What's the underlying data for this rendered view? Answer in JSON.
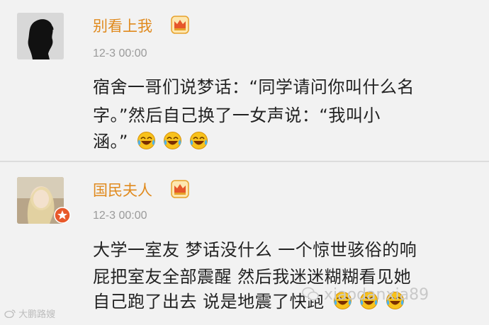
{
  "comments": [
    {
      "username": "别看上我",
      "time": "12-3 00:00",
      "lines": [
        "宿舍一哥们说梦话：“同学请问你叫什么名",
        "字。”然后自己换了一女声说：“我叫小",
        "涵。”"
      ],
      "emojis": [
        "laugh-cry-emoji",
        "laugh-cry-emoji",
        "laugh-cry-emoji"
      ]
    },
    {
      "username": "国民夫人",
      "time": "12-3 00:00",
      "lines": [
        "大学一室友 梦话没什么 一个惊世骇俗的响",
        "屁把室友全部震醒 然后我迷迷糊糊看见她",
        "自己跑了出去 说是地震了快跑"
      ],
      "emojis": [
        "laugh-cry-emoji",
        "laugh-cry-emoji",
        "laugh-cry-emoji"
      ]
    }
  ],
  "watermarks": {
    "left": "大鹏路嫂",
    "right": "xiaodanxia89"
  },
  "colors": {
    "username": "#e08a1e",
    "text": "#222222",
    "time": "#9a9a9a",
    "background": "#f2f2f2"
  }
}
